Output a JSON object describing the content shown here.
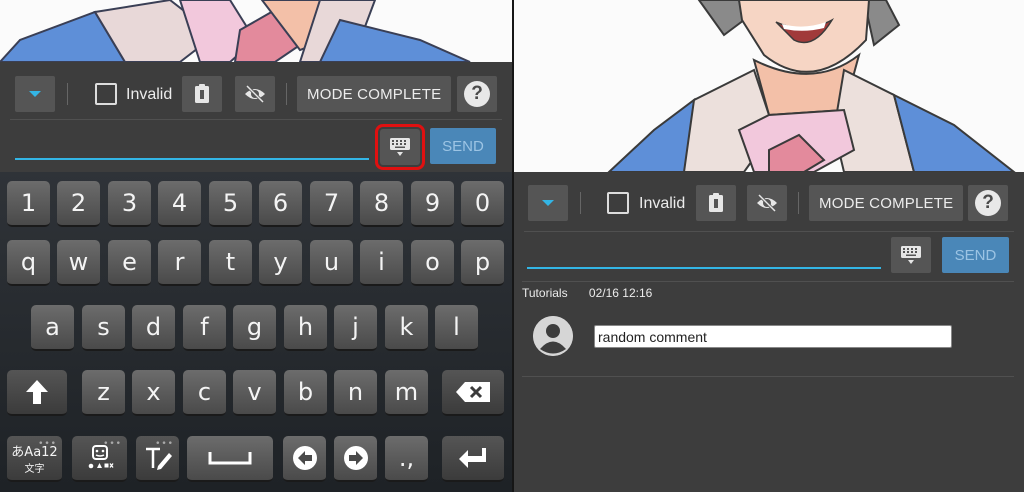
{
  "left": {
    "toolbar": {
      "invalid_label": "Invalid",
      "mode_label": "MODE COMPLETE",
      "help_label": "?"
    },
    "input": {
      "value": "",
      "send_label": "SEND"
    },
    "keyboard": {
      "row_numbers": [
        "1",
        "2",
        "3",
        "4",
        "5",
        "6",
        "7",
        "8",
        "9",
        "0"
      ],
      "row_top": [
        "q",
        "w",
        "e",
        "r",
        "t",
        "y",
        "u",
        "i",
        "o",
        "p"
      ],
      "row_middle": [
        "a",
        "s",
        "d",
        "f",
        "g",
        "h",
        "j",
        "k",
        "l"
      ],
      "row_bottom": [
        "z",
        "x",
        "c",
        "v",
        "b",
        "n",
        "m"
      ],
      "mode_key_label": "あAa12",
      "mode_key_sub": "文字",
      "punct_label": ".,",
      "dots": "•••"
    }
  },
  "right": {
    "toolbar": {
      "invalid_label": "Invalid",
      "mode_label": "MODE COMPLETE",
      "help_label": "?"
    },
    "input": {
      "value": "",
      "send_label": "SEND"
    },
    "comments": {
      "author": "Tutorials",
      "timestamp": "02/16 12:16",
      "items": [
        {
          "text": "random comment"
        }
      ]
    }
  },
  "colors": {
    "accent": "#33b5e5",
    "send_bg": "#4a87b8",
    "highlight": "#e01010"
  },
  "icons": {
    "dropdown": "dropdown-arrow-icon",
    "clipboard": "clipboard-icon",
    "hide": "visibility-off-icon",
    "keyboard": "keyboard-icon",
    "help": "help-icon",
    "avatar": "user-avatar-icon"
  }
}
